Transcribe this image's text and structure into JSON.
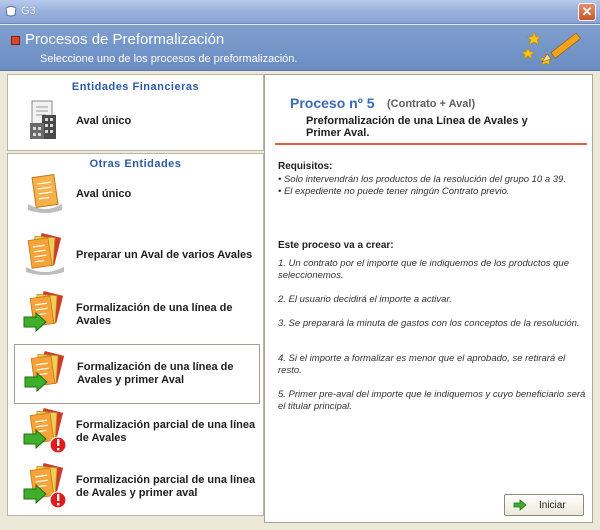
{
  "window": {
    "title": "G3",
    "close_glyph": "✕"
  },
  "header": {
    "title": "Procesos de Preformalización",
    "subtitle": "Seleccione uno de los procesos de preformalización."
  },
  "groups": {
    "financieras": {
      "title": "Entidades Financieras",
      "items": [
        {
          "label": "Aval único",
          "icon": "building-documents-icon"
        }
      ]
    },
    "otras": {
      "title": "Otras Entidades",
      "items": [
        {
          "label": "Aval único",
          "icon": "document-icon"
        },
        {
          "label": "Preparar un Aval de varios Avales",
          "icon": "documents-stack-icon"
        },
        {
          "label": "Formalización de una línea de Avales",
          "icon": "documents-arrow-icon"
        },
        {
          "label": "Formalización de una línea de Avales y primer Aval",
          "icon": "documents-arrow-icon"
        },
        {
          "label": "Formalización parcial de una línea de Avales",
          "icon": "documents-arrow-warning-icon"
        },
        {
          "label": "Formalización parcial de una línea de Avales y primer aval",
          "icon": "documents-arrow-warning-icon"
        }
      ],
      "selected_index": 3
    }
  },
  "detail": {
    "title": "Proceso nº 5",
    "subtitle": "(Contrato + Aval)",
    "description": "Preformalización de una Línea de Avales y Primer Aval.",
    "requisitos_title": "Requisitos:",
    "requisitos": [
      "• Solo intervendrán los productos de la resolución del grupo 10 a 39.",
      "• El expediente no puede tener ningún Contrato previo."
    ],
    "crear_title": "Este proceso va a crear:",
    "crear": [
      "1. Un contrato por el importe que le indiquemos de los productos que seleccionemos.",
      "2. El usuario decidirá el importe a activar.",
      "3. Se preparará la minuta de gastos con los conceptos de la resolución.",
      "4. Si el importe a formalizar es menor que el aprobado, se retirará el resto.",
      "5. Primer pre-aval del importe que le indiquemos y cuyo beneficiario será el titular principal."
    ],
    "start_button": "Iniciar"
  },
  "colors": {
    "accent": "#3a69b8",
    "header_bg": "#7f9fce",
    "red_line": "#e25b3f",
    "group_title": "#2c5aa8"
  }
}
